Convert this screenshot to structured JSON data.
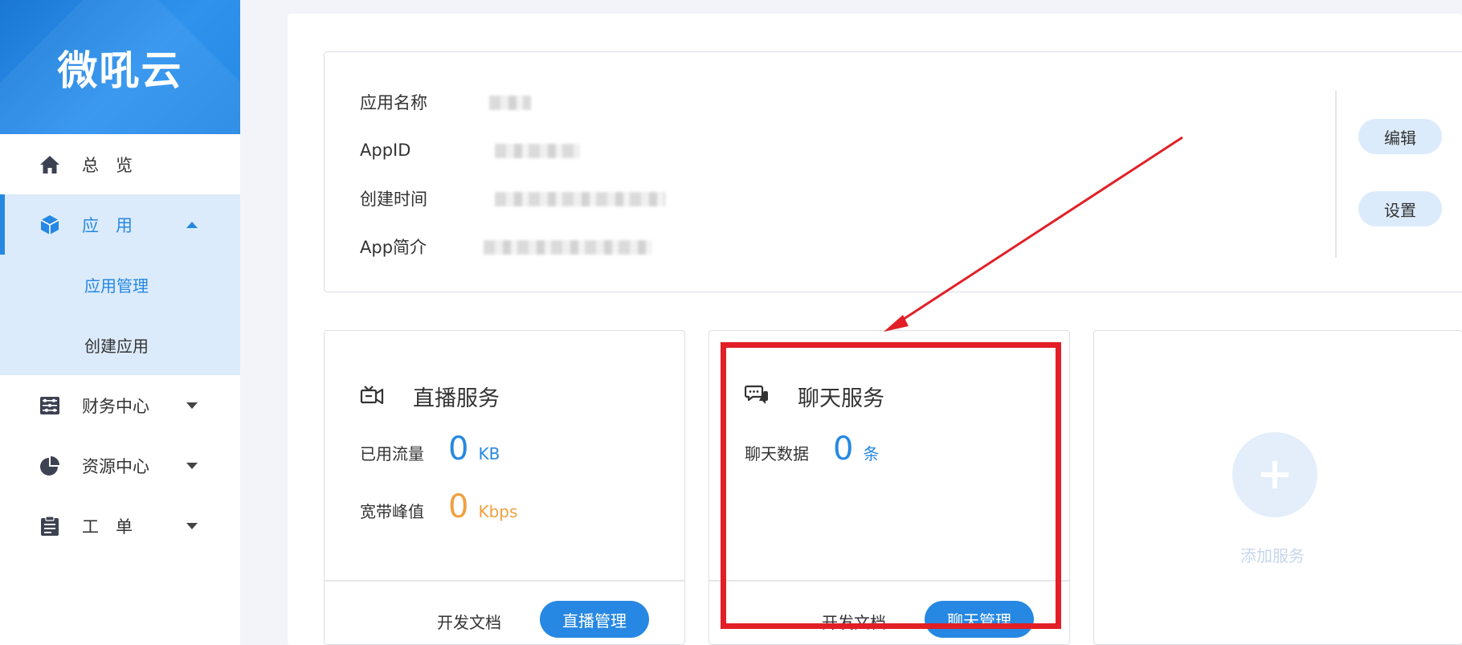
{
  "sidebar": {
    "logo": "微吼云",
    "items": [
      {
        "label": "总　览",
        "icon": "home-icon"
      },
      {
        "label": "应　用",
        "icon": "cube-icon"
      },
      {
        "label": "财务中心",
        "icon": "abacus-icon"
      },
      {
        "label": "资源中心",
        "icon": "pie-chart-icon"
      },
      {
        "label": "工　单",
        "icon": "clipboard-icon"
      }
    ],
    "sub_items": [
      "应用管理",
      "创建应用"
    ]
  },
  "info": {
    "labels": [
      "应用名称",
      "AppID",
      "创建时间",
      "App简介"
    ],
    "edit_label": "编辑",
    "settings_label": "设置"
  },
  "services": {
    "live": {
      "title": "直播服务",
      "traffic_label": "已用流量",
      "traffic_value": "0",
      "traffic_unit": "KB",
      "bandwidth_label": "宽带峰值",
      "bandwidth_value": "0",
      "bandwidth_unit": "Kbps",
      "docs_label": "开发文档",
      "manage_label": "直播管理"
    },
    "chat": {
      "title": "聊天服务",
      "data_label": "聊天数据",
      "data_value": "0",
      "data_unit": "条",
      "docs_label": "开发文档",
      "manage_label": "聊天管理"
    },
    "add": {
      "label": "添加服务"
    }
  },
  "colors": {
    "accent": "#2688e2",
    "accent_light": "#dcebfb",
    "orange": "#f0a040",
    "annotation_red": "#e21f26"
  }
}
